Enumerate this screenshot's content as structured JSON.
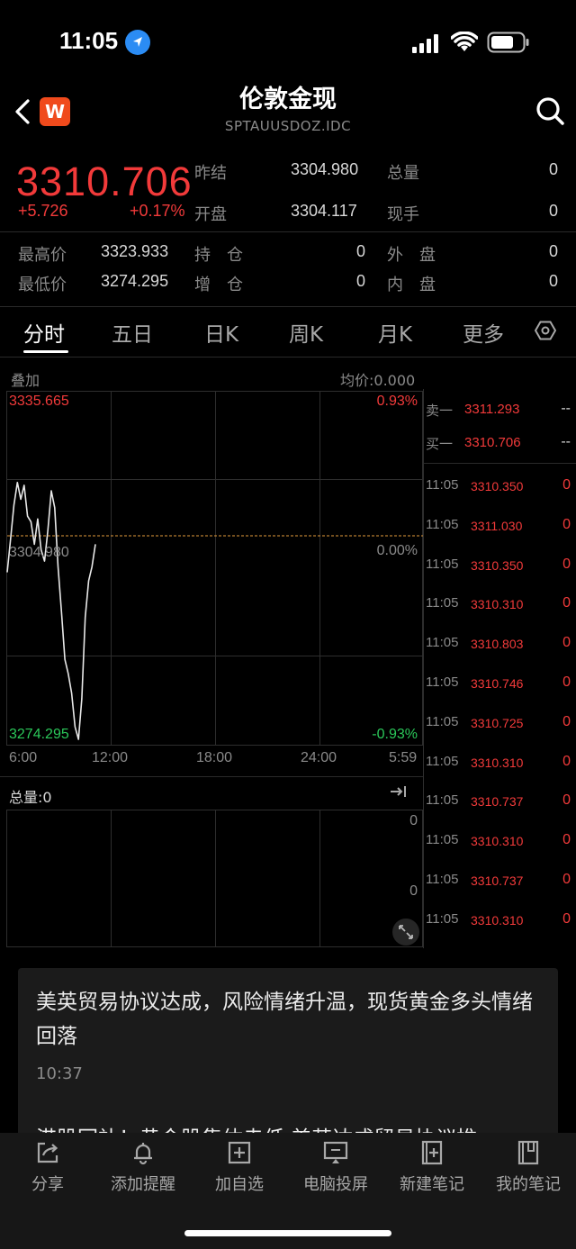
{
  "status": {
    "time": "11:05"
  },
  "header": {
    "title": "伦敦金现",
    "subtitle": "SPTAUUSDOZ.IDC",
    "logo_letter": "W"
  },
  "quote": {
    "price": "3310.706",
    "change": "+5.726",
    "change_pct": "+0.17%",
    "prev_close_label": "昨结",
    "prev_close": "3304.980",
    "open_label": "开盘",
    "open": "3304.117",
    "total_vol_label": "总量",
    "total_vol": "0",
    "cur_hand_label": "现手",
    "cur_hand": "0",
    "high_label": "最高价",
    "high": "3323.933",
    "low_label": "最低价",
    "low": "3274.295",
    "hold_label": "持　仓",
    "hold": "0",
    "add_label": "增　仓",
    "add": "0",
    "outer_label": "外　盘",
    "outer": "0",
    "inner_label": "内　盘",
    "inner": "0"
  },
  "tabs": [
    "分时",
    "五日",
    "日K",
    "周K",
    "月K",
    "更多"
  ],
  "chart": {
    "overlay_label": "叠加",
    "avg_label": "均价:0.000",
    "top_price": "3335.665",
    "top_pct": "0.93%",
    "mid_price": "3304.980",
    "mid_pct": "0.00%",
    "bot_price": "3274.295",
    "bot_pct": "-0.93%",
    "x_labels": [
      "6:00",
      "12:00",
      "18:00",
      "24:00",
      "5:59"
    ],
    "volume_label": "总量:0",
    "vol_top": "0",
    "vol_mid": "0"
  },
  "chart_data": {
    "type": "line",
    "title": "",
    "xlabel": "",
    "ylabel": "",
    "ylim": [
      3274.295,
      3335.665
    ],
    "baseline": 3304.98,
    "x": [
      "6:00",
      "12:00",
      "18:00",
      "24:00",
      "5:59"
    ],
    "series": [
      {
        "values": [
          3304.0,
          3310.0,
          3316.0,
          3320.0,
          3317.0,
          3319.5,
          3314.0,
          3313.0,
          3309.0,
          3313.5,
          3308.0,
          3306.0,
          3311.5,
          3318.5,
          3315.5,
          3305.0,
          3297.0,
          3288.5,
          3286.0,
          3282.5,
          3276.5,
          3274.3,
          3281.5,
          3296.0,
          3302.5,
          3305.0,
          3309.0
        ]
      }
    ]
  },
  "orderbook": {
    "sell1_label": "卖一",
    "sell1_price": "3311.293",
    "sell1_vol": "--",
    "buy1_label": "买一",
    "buy1_price": "3310.706",
    "buy1_vol": "--"
  },
  "ticks": [
    {
      "time": "11:05",
      "price": "3310.350",
      "vol": "0"
    },
    {
      "time": "11:05",
      "price": "3311.030",
      "vol": "0"
    },
    {
      "time": "11:05",
      "price": "3310.350",
      "vol": "0"
    },
    {
      "time": "11:05",
      "price": "3310.310",
      "vol": "0"
    },
    {
      "time": "11:05",
      "price": "3310.803",
      "vol": "0"
    },
    {
      "time": "11:05",
      "price": "3310.746",
      "vol": "0"
    },
    {
      "time": "11:05",
      "price": "3310.725",
      "vol": "0"
    },
    {
      "time": "11:05",
      "price": "3310.310",
      "vol": "0"
    },
    {
      "time": "11:05",
      "price": "3310.737",
      "vol": "0"
    },
    {
      "time": "11:05",
      "price": "3310.310",
      "vol": "0"
    },
    {
      "time": "11:05",
      "price": "3310.737",
      "vol": "0"
    },
    {
      "time": "11:05",
      "price": "3310.310",
      "vol": "0"
    }
  ],
  "news": {
    "title": "美英贸易协议达成，风险情绪升温，现货黄金多头情绪回落",
    "time": "10:37",
    "next_title": "港股回补！黄金股集体走低 美英达成贸易协议推"
  },
  "bottombar": {
    "items": [
      {
        "label": "分享",
        "icon": "share-icon"
      },
      {
        "label": "添加提醒",
        "icon": "bell-icon"
      },
      {
        "label": "加自选",
        "icon": "add-watchlist-icon"
      },
      {
        "label": "电脑投屏",
        "icon": "cast-icon"
      },
      {
        "label": "新建笔记",
        "icon": "new-note-icon"
      },
      {
        "label": "我的笔记",
        "icon": "notes-icon"
      }
    ]
  },
  "colors": {
    "up": "#f23a3a",
    "down": "#2bc85a",
    "bg": "#000000",
    "line": "#e8e8e8",
    "baseline": "#e39b3c"
  }
}
